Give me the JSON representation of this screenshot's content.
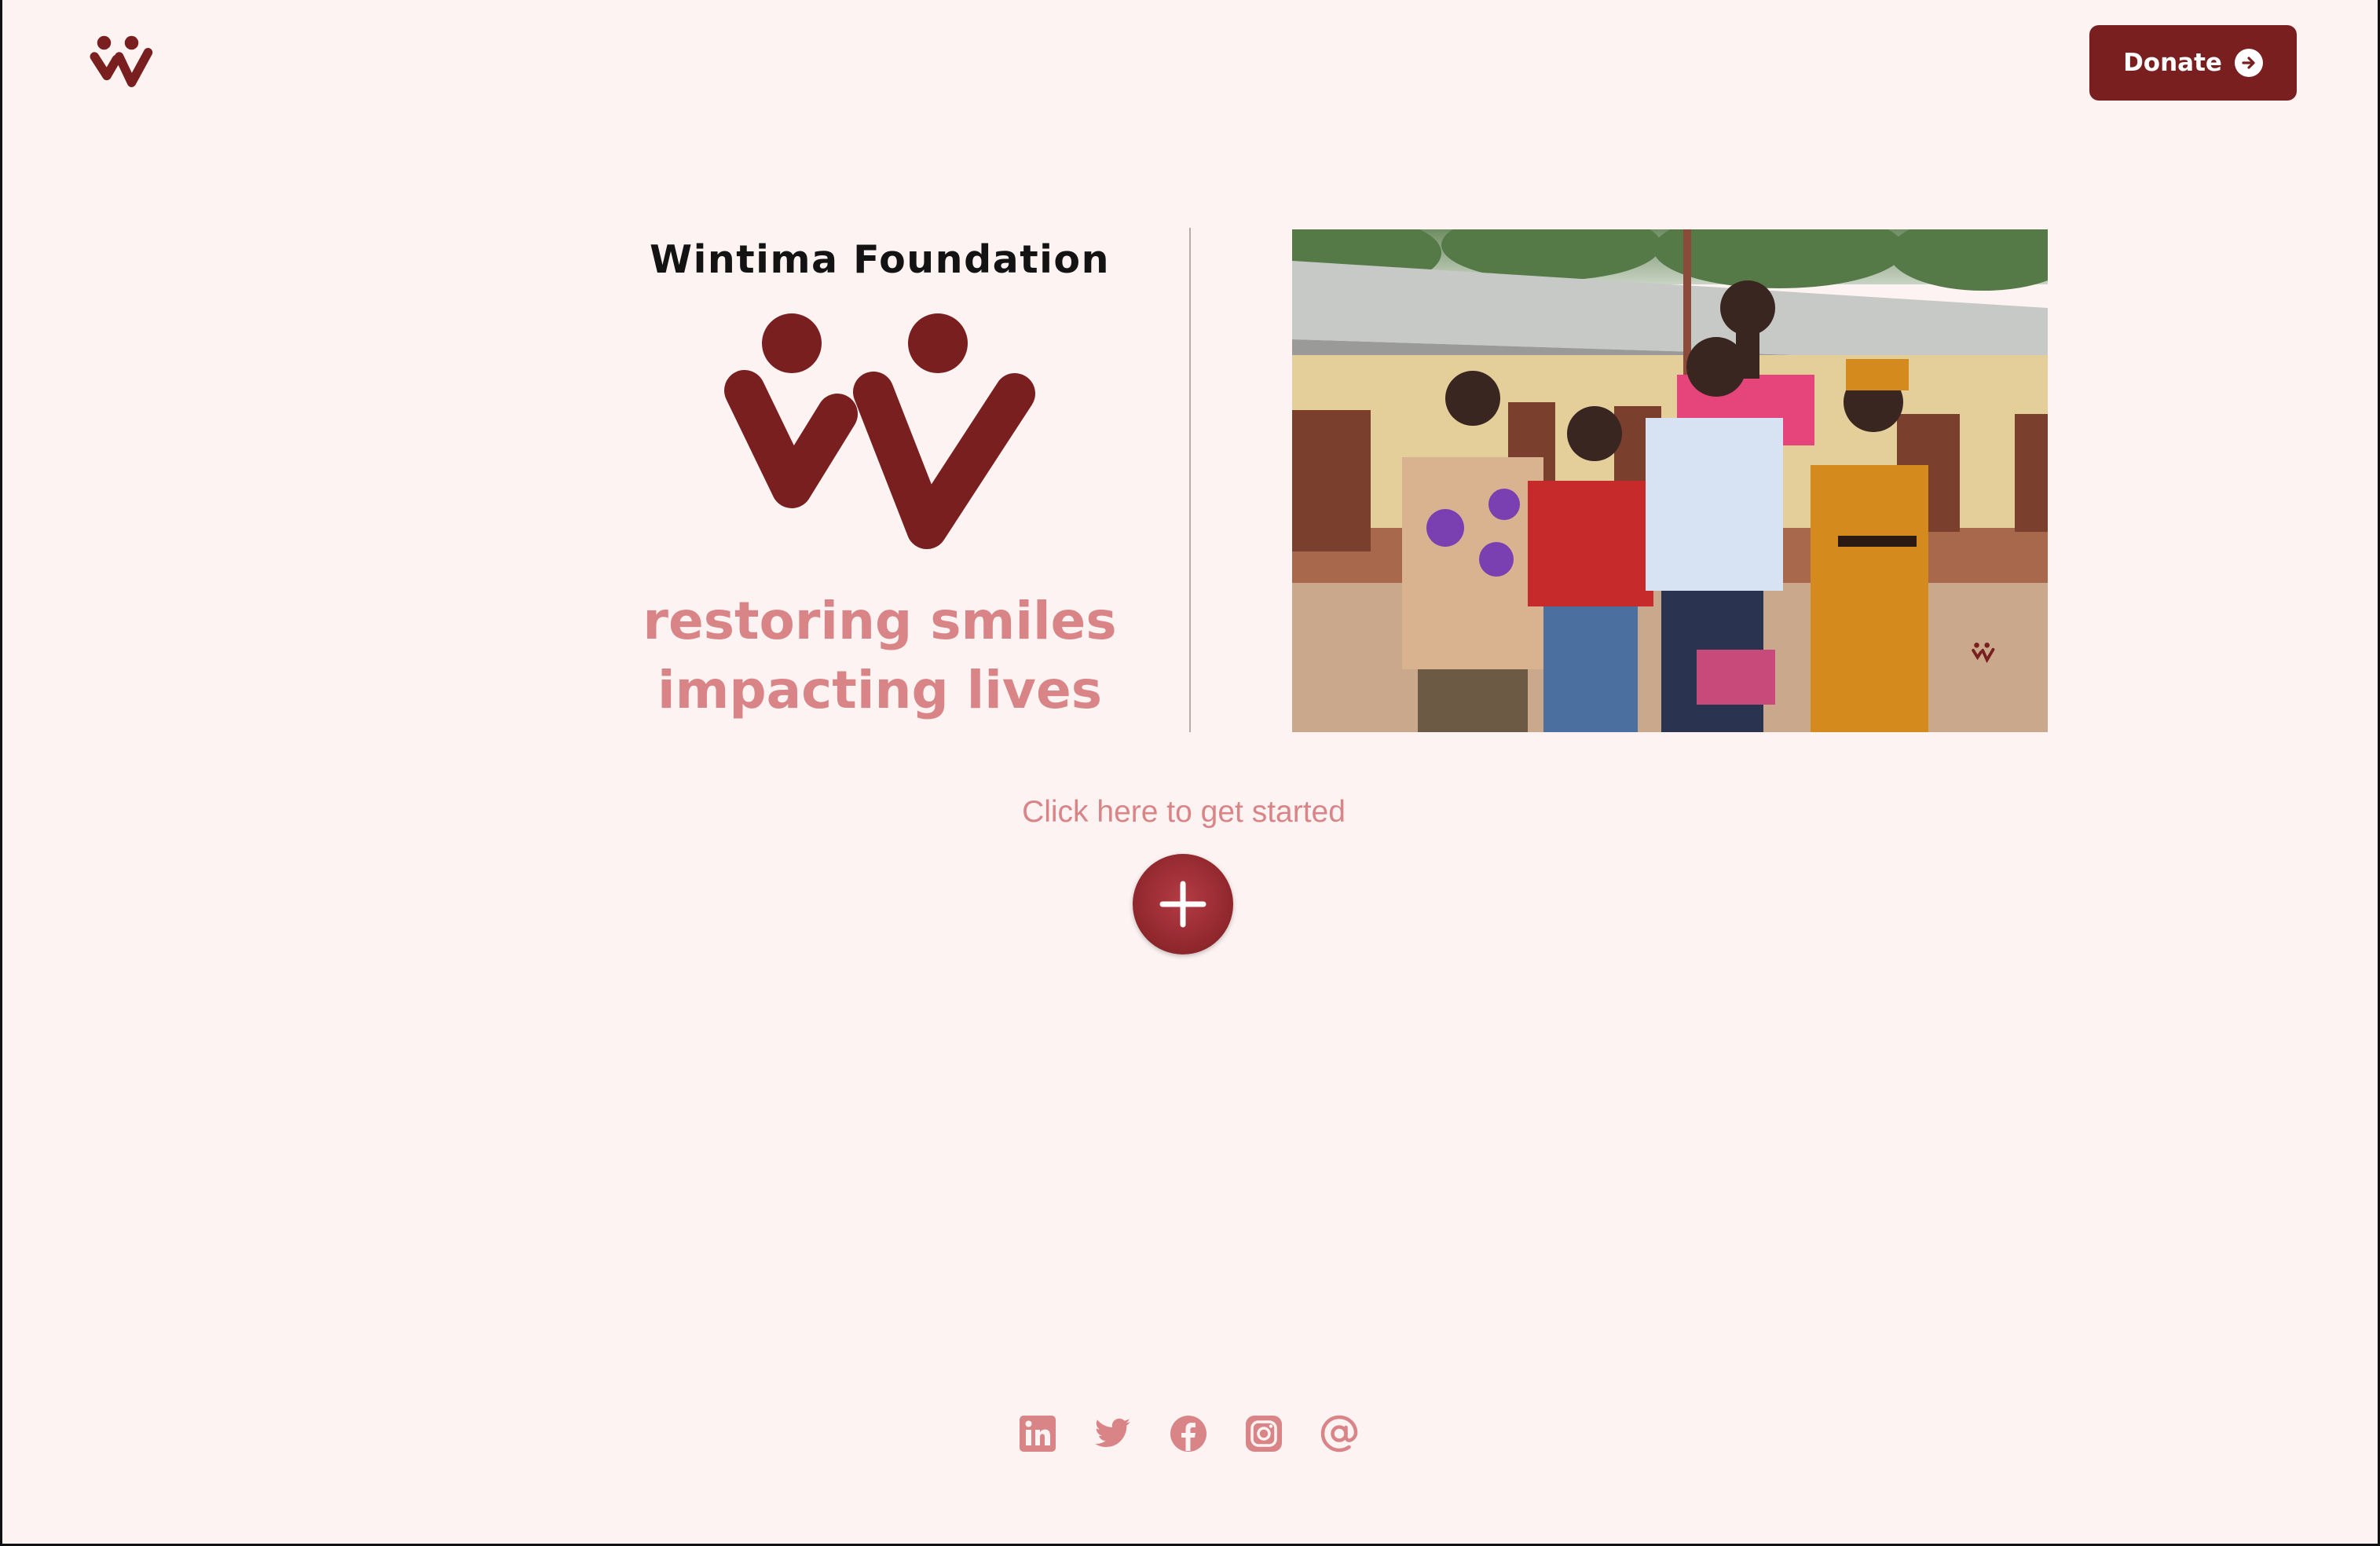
{
  "header": {
    "logo_icon": "wintima-logo-icon",
    "donate_label": "Donate",
    "donate_icon": "arrow-circle-right-icon"
  },
  "hero": {
    "title": "Wintima Foundation",
    "logo_icon": "wintima-logo-icon",
    "tagline_line1": "restoring smiles",
    "tagline_line2": "impacting lives",
    "photo_icon": "group-photo"
  },
  "cta": {
    "label": "Click here to get started",
    "button_icon": "plus-icon"
  },
  "social": {
    "icons": [
      "linkedin-icon",
      "twitter-icon",
      "facebook-icon",
      "instagram-icon",
      "email-at-icon"
    ]
  },
  "colors": {
    "background": "#fdf3f3",
    "brand": "#7a1f1f",
    "accent_pink": "#d98587",
    "text_dark": "#131313"
  }
}
